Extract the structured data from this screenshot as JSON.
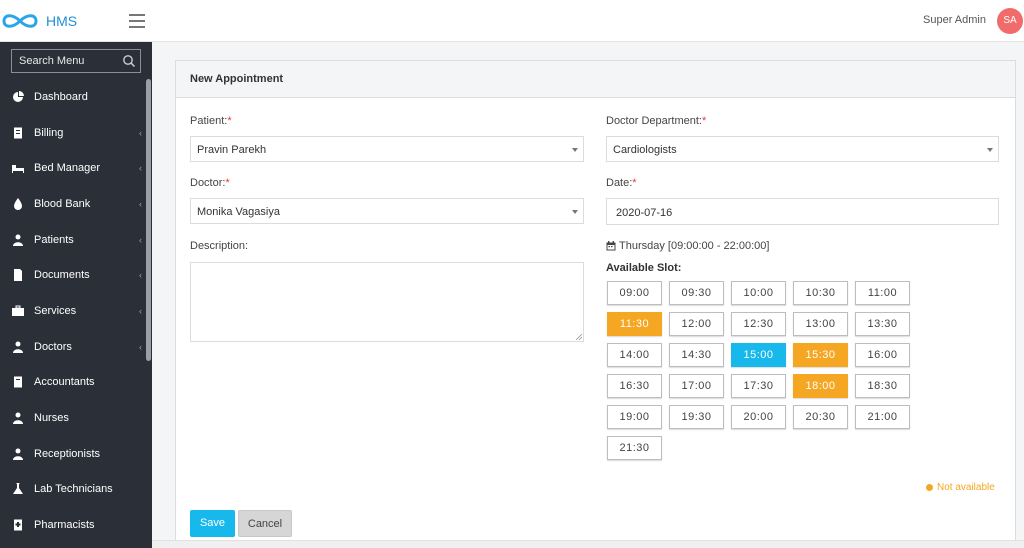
{
  "app": {
    "brand": "HMS"
  },
  "user": {
    "name": "Super Admin",
    "initials": "SA"
  },
  "sidebar": {
    "search_placeholder": "Search Menu",
    "items": [
      {
        "label": "Dashboard",
        "icon": "dashboard-icon",
        "chevron": false
      },
      {
        "label": "Billing",
        "icon": "billing-icon",
        "chevron": true
      },
      {
        "label": "Bed Manager",
        "icon": "bed-icon",
        "chevron": true
      },
      {
        "label": "Blood Bank",
        "icon": "blood-drop-icon",
        "chevron": true
      },
      {
        "label": "Patients",
        "icon": "patient-icon",
        "chevron": true
      },
      {
        "label": "Documents",
        "icon": "document-icon",
        "chevron": true
      },
      {
        "label": "Services",
        "icon": "services-icon",
        "chevron": true
      },
      {
        "label": "Doctors",
        "icon": "doctor-icon",
        "chevron": true
      },
      {
        "label": "Accountants",
        "icon": "accountant-icon",
        "chevron": false
      },
      {
        "label": "Nurses",
        "icon": "nurse-icon",
        "chevron": false
      },
      {
        "label": "Receptionists",
        "icon": "receptionist-icon",
        "chevron": false
      },
      {
        "label": "Lab Technicians",
        "icon": "lab-icon",
        "chevron": false
      },
      {
        "label": "Pharmacists",
        "icon": "pharmacist-icon",
        "chevron": false
      }
    ]
  },
  "form": {
    "title": "New Appointment",
    "patient_label": "Patient:",
    "patient_value": "Pravin Parekh",
    "department_label": "Doctor Department:",
    "department_value": "Cardiologists",
    "doctor_label": "Doctor:",
    "doctor_value": "Monika Vagasiya",
    "date_label": "Date:",
    "date_value": "2020-07-16",
    "description_label": "Description:",
    "required_mark": "*",
    "schedule_text": "Thursday [09:00:00 - 22:00:00]",
    "slots_label": "Available Slot:",
    "slots": [
      {
        "time": "09:00",
        "state": "free"
      },
      {
        "time": "09:30",
        "state": "free"
      },
      {
        "time": "10:00",
        "state": "free"
      },
      {
        "time": "10:30",
        "state": "free"
      },
      {
        "time": "11:00",
        "state": "free"
      },
      {
        "time": "11:30",
        "state": "booked"
      },
      {
        "time": "12:00",
        "state": "free"
      },
      {
        "time": "12:30",
        "state": "free"
      },
      {
        "time": "13:00",
        "state": "free"
      },
      {
        "time": "13:30",
        "state": "free"
      },
      {
        "time": "14:00",
        "state": "free"
      },
      {
        "time": "14:30",
        "state": "free"
      },
      {
        "time": "15:00",
        "state": "selected"
      },
      {
        "time": "15:30",
        "state": "booked"
      },
      {
        "time": "16:00",
        "state": "free"
      },
      {
        "time": "16:30",
        "state": "free"
      },
      {
        "time": "17:00",
        "state": "free"
      },
      {
        "time": "17:30",
        "state": "free"
      },
      {
        "time": "18:00",
        "state": "booked"
      },
      {
        "time": "18:30",
        "state": "free"
      },
      {
        "time": "19:00",
        "state": "free"
      },
      {
        "time": "19:30",
        "state": "free"
      },
      {
        "time": "20:00",
        "state": "free"
      },
      {
        "time": "20:30",
        "state": "free"
      },
      {
        "time": "21:00",
        "state": "free"
      },
      {
        "time": "21:30",
        "state": "free"
      }
    ],
    "legend_not_available": "Not available",
    "save_label": "Save",
    "cancel_label": "Cancel"
  },
  "colors": {
    "sidebar_bg": "#2a2f38",
    "accent": "#17b8ec",
    "booked": "#f5a623",
    "avatar": "#f26b6b",
    "brand": "#1e8fd6"
  }
}
